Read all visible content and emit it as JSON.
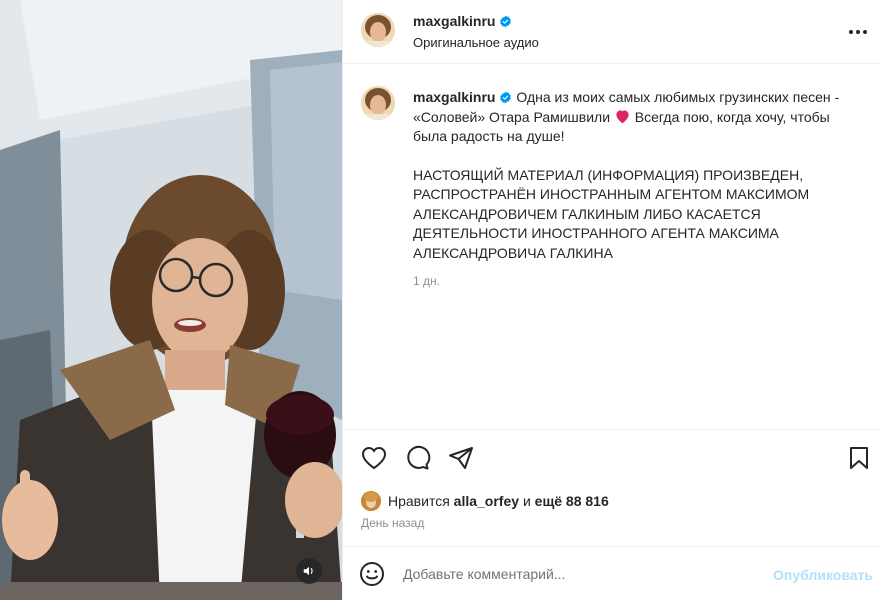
{
  "post": {
    "username": "maxgalkinru",
    "audio_label": "Оригинальное аудио",
    "verified_icon": "verified-badge-icon",
    "accent_color": "#0095f6"
  },
  "caption": {
    "username": "maxgalkinru",
    "text_before_emoji": "Одна из моих самых любимых грузинских песен - «Соловей» Отара Рамишвили",
    "emoji": "heart-emoji",
    "text_after_emoji": " Всегда пою, когда хочу, чтобы была радость на душе!",
    "notice": "НАСТОЯЩИЙ МАТЕРИАЛ (ИНФОРМАЦИЯ) ПРОИЗВЕДЕН, РАСПРОСТРАНЁН ИНОСТРАННЫМ АГЕНТОМ МАКСИМОМ АЛЕКСАНДРОВИЧЕМ ГАЛКИНЫМ ЛИБО КАСАЕТСЯ ДЕЯТЕЛЬНОСТИ ИНОСТРАННОГО АГЕНТА МАКСИМА АЛЕКСАНДРОВИЧА ГАЛКИНА",
    "time": "1 дн."
  },
  "actions": {
    "like_icon": "heart-icon",
    "comment_icon": "comment-icon",
    "share_icon": "share-icon",
    "save_icon": "bookmark-icon"
  },
  "likes": {
    "prefix": "Нравится",
    "liked_by": "alla_orfey",
    "conjunction": "и",
    "others": "ещё 88 816"
  },
  "date": "День назад",
  "comment": {
    "placeholder": "Добавьте комментарий...",
    "post_label": "Опубликовать",
    "post_color": "#b2dffc"
  }
}
